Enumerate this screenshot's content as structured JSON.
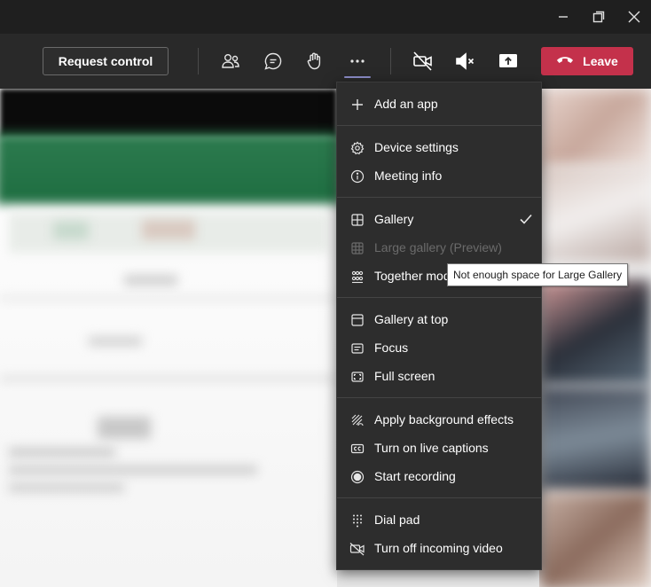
{
  "toolbar": {
    "request_control_label": "Request control",
    "leave_label": "Leave",
    "leave_color": "#c4314b",
    "icons": [
      "people-icon",
      "chat-icon",
      "raise-hand-icon",
      "more-actions-icon",
      "camera-off-icon",
      "mic-off-icon",
      "share-screen-icon"
    ]
  },
  "window": {
    "controls": [
      "minimize-icon",
      "restore-icon",
      "close-icon"
    ]
  },
  "menu": {
    "items": [
      {
        "label": "Add an app",
        "icon": "plus-icon"
      },
      {
        "label": "Device settings",
        "icon": "gear-icon"
      },
      {
        "label": "Meeting info",
        "icon": "info-icon"
      },
      {
        "label": "Gallery",
        "icon": "gallery-grid-icon",
        "checked": true
      },
      {
        "label": "Large gallery (Preview)",
        "icon": "large-gallery-icon",
        "disabled": true
      },
      {
        "label": "Together mode",
        "icon": "together-mode-icon"
      },
      {
        "label": "Gallery at top",
        "icon": "gallery-top-icon"
      },
      {
        "label": "Focus",
        "icon": "focus-icon"
      },
      {
        "label": "Full screen",
        "icon": "full-screen-icon"
      },
      {
        "label": "Apply background effects",
        "icon": "background-effects-icon"
      },
      {
        "label": "Turn on live captions",
        "icon": "captions-icon"
      },
      {
        "label": "Start recording",
        "icon": "record-icon"
      },
      {
        "label": "Dial pad",
        "icon": "dial-pad-icon"
      },
      {
        "label": "Turn off incoming video",
        "icon": "video-off-icon"
      }
    ]
  },
  "tooltip": {
    "text": "Not enough space for Large Gallery"
  }
}
